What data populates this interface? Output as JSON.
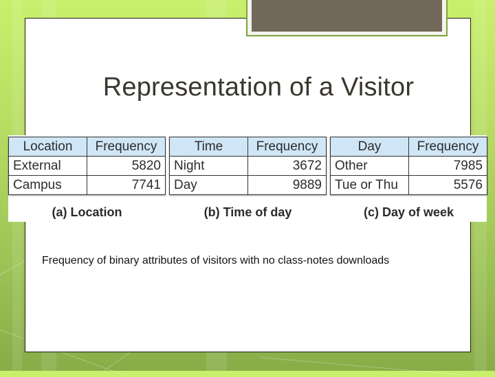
{
  "slide": {
    "title": "Representation of a Visitor",
    "caption": "Frequency of binary attributes of visitors with no class-notes downloads"
  },
  "tables": [
    {
      "caption": "(a) Location",
      "headers": [
        "Location",
        "Frequency"
      ],
      "rows": [
        {
          "label": "External",
          "value": "5820"
        },
        {
          "label": "Campus",
          "value": "7741"
        }
      ]
    },
    {
      "caption": "(b) Time of day",
      "headers": [
        "Time",
        "Frequency"
      ],
      "rows": [
        {
          "label": "Night",
          "value": "3672"
        },
        {
          "label": "Day",
          "value": "9889"
        }
      ]
    },
    {
      "caption": "(c) Day of week",
      "headers": [
        "Day",
        "Frequency"
      ],
      "rows": [
        {
          "label": "Other",
          "value": "7985"
        },
        {
          "label": "Tue or Thu",
          "value": "5576"
        }
      ]
    }
  ],
  "colors": {
    "header_bg": "#cfe6f6",
    "banner": "#72695a",
    "banner_border": "#7fa33a",
    "background_top": "#c9f06c",
    "background_bottom": "#88ad48"
  }
}
